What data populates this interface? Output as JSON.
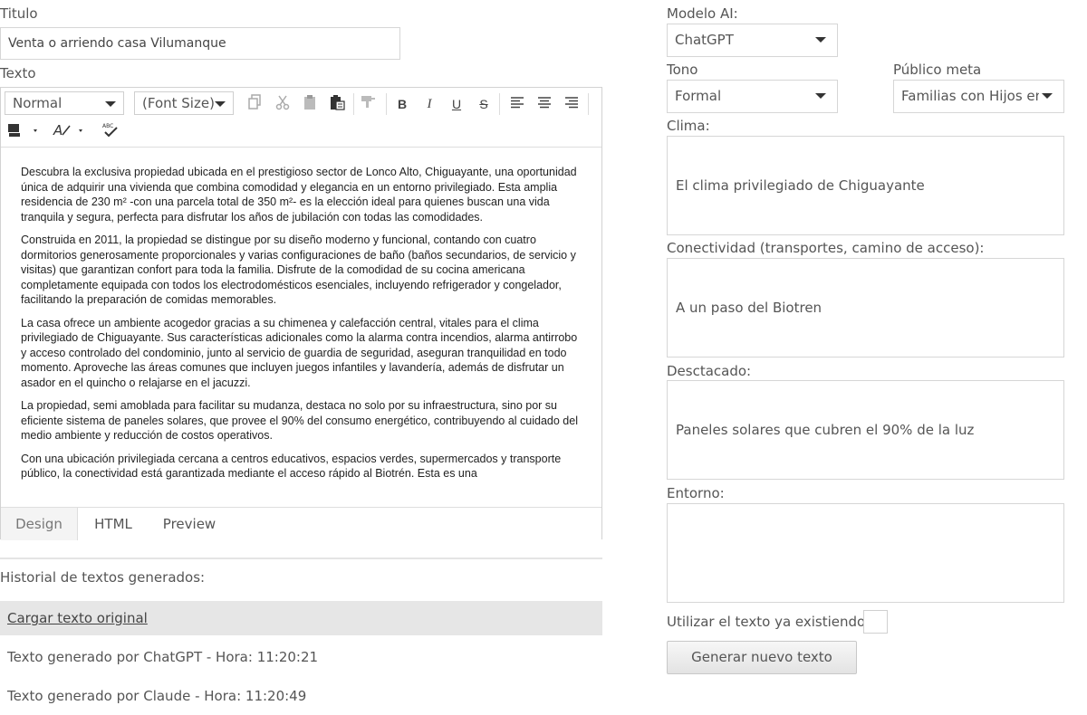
{
  "form": {
    "title_label": "Titulo",
    "title_value": "Venta o arriendo casa Vilumanque",
    "text_label": "Texto"
  },
  "toolbar": {
    "format_select": "Normal",
    "fontsize_select": "(Font Size)",
    "icons": [
      "copy-icon",
      "cut-icon",
      "paste-icon",
      "paste-text-icon",
      "paste-word-icon",
      "format-painter-icon",
      "bold-icon",
      "italic-icon",
      "underline-icon",
      "strikethrough-icon",
      "align-left-icon",
      "align-center-icon",
      "align-right-icon",
      "text-color-icon",
      "background-color-icon",
      "spellcheck-icon"
    ],
    "bold": "B",
    "italic": "I",
    "underline": "U",
    "strike": "S"
  },
  "editor": {
    "paragraphs": [
      "Descubra la exclusiva propiedad ubicada en el prestigioso sector de Lonco Alto, Chiguayante, una oportunidad única de adquirir una vivienda que combina comodidad y elegancia en un entorno privilegiado. Esta amplia residencia de 230 m² -con una parcela total de 350 m²- es la elección ideal para quienes buscan una vida tranquila y segura, perfecta para disfrutar los años de jubilación con todas las comodidades.",
      "Construida en 2011, la propiedad se distingue por su diseño moderno y funcional, contando con cuatro dormitorios generosamente proporcionales y varias configuraciones de baño (baños secundarios, de servicio y visitas) que garantizan confort para toda la familia. Disfrute de la comodidad de su cocina americana completamente equipada con todos los electrodomésticos esenciales, incluyendo refrigerador y congelador, facilitando la preparación de comidas memorables.",
      "La casa ofrece un ambiente acogedor gracias a su chimenea y calefacción central, vitales para el clima privilegiado de Chiguayante. Sus características adicionales como la alarma contra incendios, alarma antirrobo y acceso controlado del condominio, junto al servicio de guardia de seguridad, aseguran tranquilidad en todo momento. Aproveche las áreas comunes que incluyen juegos infantiles y lavandería, además de disfrutar un asador en el quincho o relajarse en el jacuzzi.",
      "La propiedad, semi amoblada para facilitar su mudanza, destaca no solo por su infraestructura, sino por su eficiente sistema de paneles solares, que provee el 90% del consumo energético, contribuyendo al cuidado del medio ambiente y reducción de costos operativos.",
      "Con una ubicación privilegiada cercana a centros educativos, espacios verdes, supermercados y transporte público, la conectividad está garantizada mediante el acceso rápido al Biotrén. Esta es una"
    ],
    "tabs": [
      "Design",
      "HTML",
      "Preview"
    ]
  },
  "history": {
    "label": "Historial de textos generados:",
    "load_original": "Cargar texto original",
    "items": [
      "Texto generado por ChatGPT - Hora: 11:20:21",
      "Texto generado por Claude - Hora: 11:20:49"
    ]
  },
  "settings": {
    "model_label": "Modelo AI:",
    "model_value": "ChatGPT",
    "tone_label": "Tono",
    "tone_value": "Formal",
    "audience_label": "Público meta",
    "audience_value": "Familias con Hijos en Edad Escolar",
    "climate_label": "Clima:",
    "climate_value": "El clima privilegiado de Chiguayante",
    "connectivity_label": "Conectividad (transportes, camino de acceso):",
    "connectivity_value": "A un paso del Biotren",
    "highlight_label": "Desctacado:",
    "highlight_value": "Paneles solares que cubren el 90% de la luz",
    "environment_label": "Entorno:",
    "environment_value": "",
    "reuse_label": "Utilizar el texto ya existiendo:",
    "reuse_checked": false,
    "generate_button": "Generar nuevo texto"
  }
}
